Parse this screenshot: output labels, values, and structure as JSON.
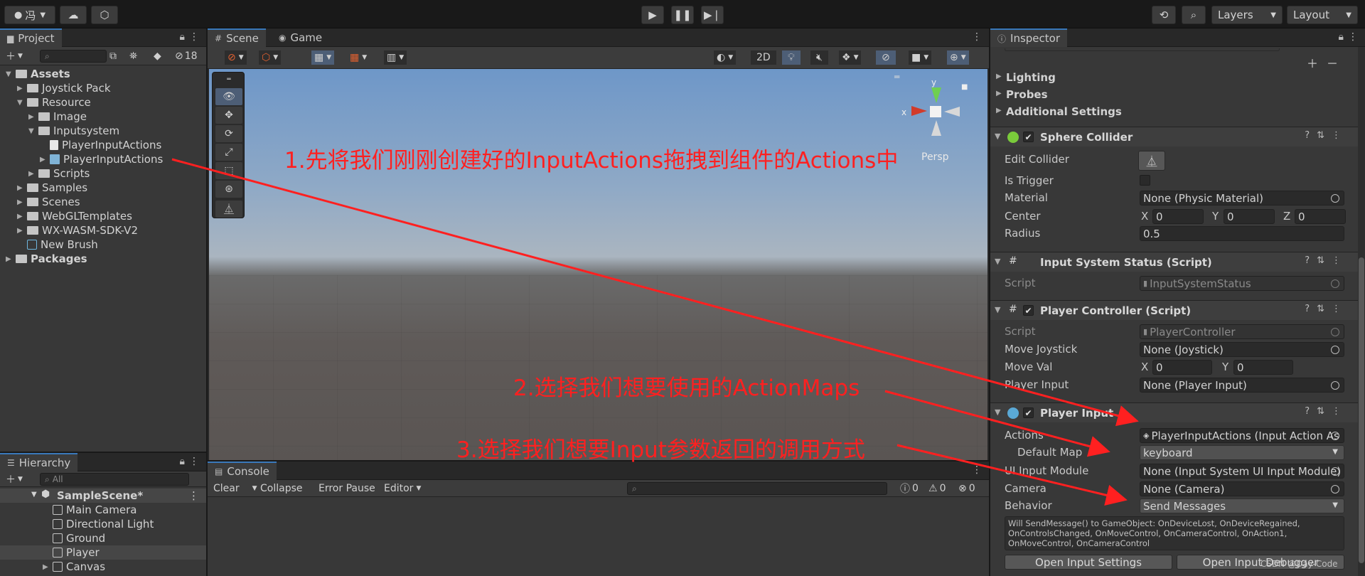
{
  "toolbar": {
    "account_label": "冯",
    "layers_label": "Layers",
    "layout_label": "Layout"
  },
  "project": {
    "tab_label": "Project",
    "hidden_count": "18",
    "tree": [
      {
        "label": "Assets",
        "depth": 0,
        "arrow": "▼",
        "bold": true,
        "kind": "folder"
      },
      {
        "label": "Joystick Pack",
        "depth": 1,
        "arrow": "▶",
        "bold": false,
        "kind": "folder"
      },
      {
        "label": "Resource",
        "depth": 1,
        "arrow": "▼",
        "bold": false,
        "kind": "folder"
      },
      {
        "label": "Image",
        "depth": 2,
        "arrow": "▶",
        "bold": false,
        "kind": "folder"
      },
      {
        "label": "Inputsystem",
        "depth": 2,
        "arrow": "▼",
        "bold": false,
        "kind": "folder"
      },
      {
        "label": "PlayerInputActions",
        "depth": 3,
        "arrow": "",
        "bold": false,
        "kind": "script"
      },
      {
        "label": "PlayerInputActions",
        "depth": 3,
        "arrow": "▶",
        "bold": false,
        "kind": "asset"
      },
      {
        "label": "Scripts",
        "depth": 2,
        "arrow": "▶",
        "bold": false,
        "kind": "folder"
      },
      {
        "label": "Samples",
        "depth": 1,
        "arrow": "▶",
        "bold": false,
        "kind": "folder"
      },
      {
        "label": "Scenes",
        "depth": 1,
        "arrow": "▶",
        "bold": false,
        "kind": "folder"
      },
      {
        "label": "WebGLTemplates",
        "depth": 1,
        "arrow": "▶",
        "bold": false,
        "kind": "folder"
      },
      {
        "label": "WX-WASM-SDK-V2",
        "depth": 1,
        "arrow": "▶",
        "bold": false,
        "kind": "folder"
      },
      {
        "label": "New Brush",
        "depth": 1,
        "arrow": "",
        "bold": false,
        "kind": "cube"
      },
      {
        "label": "Packages",
        "depth": 0,
        "arrow": "▶",
        "bold": true,
        "kind": "folder"
      }
    ]
  },
  "hierarchy": {
    "tab_label": "Hierarchy",
    "search_placeholder": "All",
    "scene_name": "SampleScene*",
    "items": [
      {
        "label": "Main Camera",
        "arrow": ""
      },
      {
        "label": "Directional Light",
        "arrow": ""
      },
      {
        "label": "Ground",
        "arrow": ""
      },
      {
        "label": "Player",
        "arrow": ""
      },
      {
        "label": "Canvas",
        "arrow": "▶"
      }
    ]
  },
  "scene": {
    "tab_scene": "Scene",
    "tab_game": "Game",
    "btn_2d": "2D",
    "persp_label": "Persp",
    "gizmo_x": "x",
    "gizmo_y": "y"
  },
  "console": {
    "tab_label": "Console",
    "clear": "Clear",
    "collapse": "Collapse",
    "error_pause": "Error Pause",
    "editor": "Editor",
    "count_log": "0",
    "count_warn": "0",
    "count_err": "0"
  },
  "annotations": {
    "step1": "1.先将我们刚刚创建好的InputActions拖拽到组件的Actions中",
    "step2": "2.选择我们想要使用的ActionMaps",
    "step3": "3.选择我们想要Input参数返回的调用方式",
    "color": "#ff2020"
  },
  "inspector": {
    "tab_label": "Inspector",
    "sections": [
      "Lighting",
      "Probes",
      "Additional Settings"
    ],
    "sphere": {
      "title": "Sphere Collider",
      "edit_collider": "Edit Collider",
      "is_trigger": "Is Trigger",
      "material_label": "Material",
      "material_value": "None (Physic Material)",
      "center_label": "Center",
      "center_x": "0",
      "center_y": "0",
      "center_z": "0",
      "radius_label": "Radius",
      "radius_value": "0.5"
    },
    "iss": {
      "title": "Input System Status (Script)",
      "script_label": "Script",
      "script_value": "InputSystemStatus"
    },
    "pc": {
      "title": "Player Controller (Script)",
      "script_label": "Script",
      "script_value": "PlayerController",
      "joystick_label": "Move Joystick",
      "joystick_value": "None (Joystick)",
      "moveval_label": "Move Val",
      "moveval_x": "0",
      "moveval_y": "0",
      "playerinput_label": "Player Input",
      "playerinput_value": "None (Player Input)"
    },
    "pi": {
      "title": "Player Input",
      "actions_label": "Actions",
      "actions_value": "PlayerInputActions (Input Action As",
      "defaultmap_label": "Default Map",
      "defaultmap_value": "keyboard",
      "uimodule_label": "UI Input Module",
      "uimodule_value": "None (Input System UI Input Module)",
      "camera_label": "Camera",
      "camera_value": "None (Camera)",
      "behavior_label": "Behavior",
      "behavior_value": "Send Messages",
      "help_text": "Will SendMessage() to GameObject: OnDeviceLost, OnDeviceRegained, OnControlsChanged, OnMoveControl, OnCameraControl, OnAction1, OnMoveControl, OnCameraControl",
      "btn_settings": "Open Input Settings",
      "btn_debugger": "Open Input Debugger"
    },
    "watermark": "CSDN @Day-Code"
  }
}
